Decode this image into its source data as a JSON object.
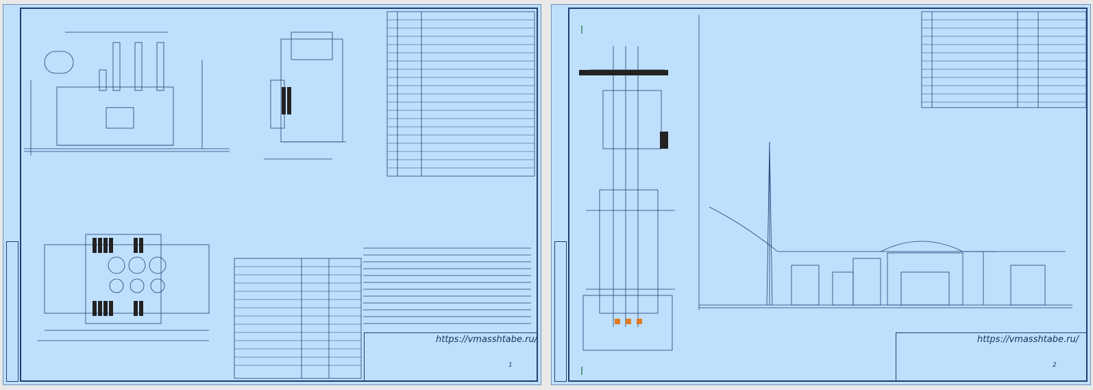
{
  "sheets": [
    {
      "id": "left",
      "title_block": {
        "url": "https://vmasshtabe.ru/",
        "sheet_number": "1"
      }
    },
    {
      "id": "right",
      "title_block": {
        "url": "https://vmasshtabe.ru/",
        "sheet_number": "2"
      }
    }
  ],
  "colors": {
    "sheet_bg": "#bfe0fd",
    "line": "#1d3d70",
    "frame_red": "#c83232",
    "accent_orange": "#e07a1f"
  }
}
